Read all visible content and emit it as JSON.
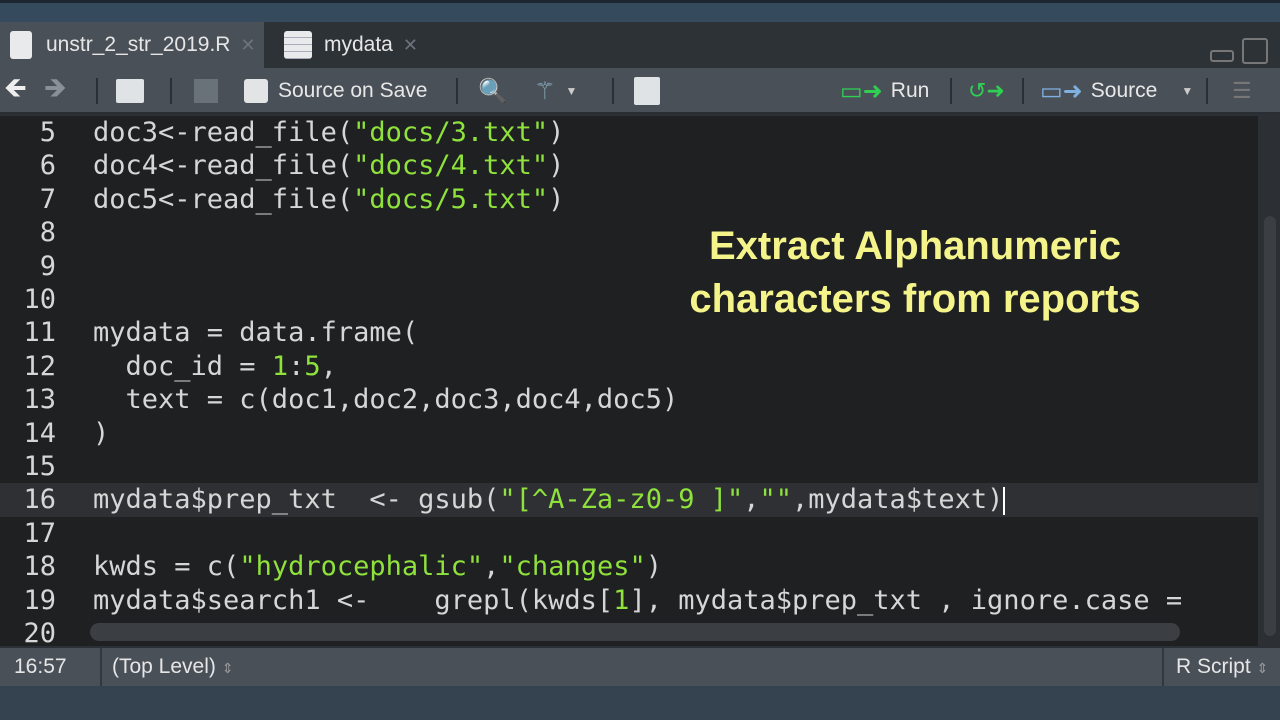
{
  "tabs": [
    {
      "label": "unstr_2_str_2019.R",
      "icon": "r-file-icon",
      "active": true
    },
    {
      "label": "mydata",
      "icon": "grid-icon",
      "active": false
    }
  ],
  "toolbar": {
    "source_on_save": "Source on Save",
    "run": "Run",
    "source": "Source"
  },
  "editor": {
    "lines": [
      {
        "n": "5",
        "seg": [
          [
            "doc3<-read_file(",
            ""
          ],
          [
            "\"docs/3.txt\"",
            "s"
          ],
          [
            ")",
            ""
          ]
        ]
      },
      {
        "n": "6",
        "seg": [
          [
            "doc4<-read_file(",
            ""
          ],
          [
            "\"docs/4.txt\"",
            "s"
          ],
          [
            ")",
            ""
          ]
        ]
      },
      {
        "n": "7",
        "seg": [
          [
            "doc5<-read_file(",
            ""
          ],
          [
            "\"docs/5.txt\"",
            "s"
          ],
          [
            ")",
            ""
          ]
        ]
      },
      {
        "n": "8",
        "seg": []
      },
      {
        "n": "9",
        "seg": []
      },
      {
        "n": "10",
        "seg": []
      },
      {
        "n": "11",
        "seg": [
          [
            "mydata = data.frame(",
            ""
          ]
        ]
      },
      {
        "n": "12",
        "seg": [
          [
            "  doc_id = ",
            ""
          ],
          [
            "1",
            "n"
          ],
          [
            ":",
            ""
          ],
          [
            "5",
            "n"
          ],
          [
            ",",
            ""
          ]
        ]
      },
      {
        "n": "13",
        "seg": [
          [
            "  text = c(doc1,doc2,doc3,doc4,doc5)",
            ""
          ]
        ]
      },
      {
        "n": "14",
        "seg": [
          [
            ")",
            ""
          ]
        ]
      },
      {
        "n": "15",
        "seg": []
      },
      {
        "n": "16",
        "seg": [
          [
            "mydata$prep_txt  <- gsub(",
            ""
          ],
          [
            "\"[^A-Za-z0-9 ]\"",
            "s"
          ],
          [
            ",",
            ""
          ],
          [
            "\"\"",
            "s"
          ],
          [
            ",mydata$text)",
            ""
          ]
        ],
        "current": true
      },
      {
        "n": "17",
        "seg": []
      },
      {
        "n": "18",
        "seg": [
          [
            "kwds = c(",
            ""
          ],
          [
            "\"hydrocephalic\"",
            "s"
          ],
          [
            ",",
            ""
          ],
          [
            "\"changes\"",
            "s"
          ],
          [
            ")",
            ""
          ]
        ]
      },
      {
        "n": "19",
        "seg": [
          [
            "mydata$search1 <-    grepl(kwds[",
            ""
          ],
          [
            "1",
            "n"
          ],
          [
            "], mydata$prep_txt , ignore.case =",
            ""
          ]
        ]
      },
      {
        "n": "20",
        "seg": []
      }
    ]
  },
  "overlay": {
    "line1": "Extract Alphanumeric",
    "line2": "characters from reports"
  },
  "status": {
    "position": "16:57",
    "scope": "(Top Level)",
    "filetype": "R Script"
  }
}
